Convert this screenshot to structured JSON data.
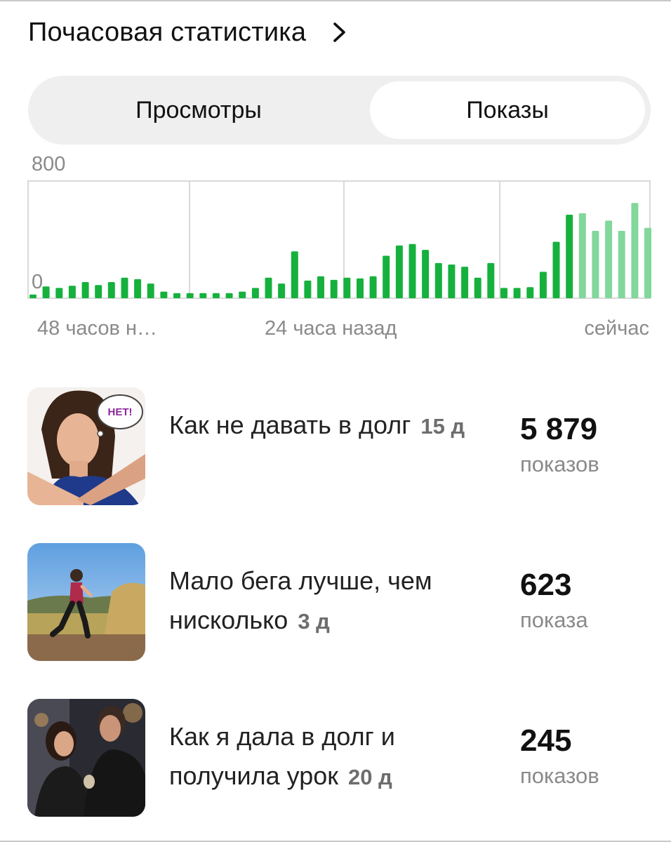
{
  "header": {
    "title": "Почасовая статистика"
  },
  "tabs": {
    "views": "Просмотры",
    "impressions": "Показы",
    "selected": "impressions"
  },
  "colors": {
    "bar_past": "#16b13d",
    "bar_recent": "#82d79b",
    "grid": "#d9d9d9"
  },
  "chart_data": {
    "type": "bar",
    "ylim": [
      0,
      800
    ],
    "y_ticks": [
      "800",
      "0"
    ],
    "x_labels": [
      "48 часов н…",
      "24 часа назад",
      "сейчас"
    ],
    "grid": true,
    "series": [
      {
        "values": [
          25,
          80,
          70,
          85,
          110,
          90,
          110,
          140,
          130,
          100,
          45,
          35,
          35,
          35,
          35,
          35,
          45,
          70,
          140,
          100,
          320,
          120,
          150,
          125,
          140,
          135,
          150,
          290,
          360,
          370,
          330,
          240,
          230,
          215,
          140,
          240,
          70,
          70,
          75,
          180,
          385,
          570,
          580,
          460,
          530,
          460,
          650,
          480
        ],
        "recent_count": 6
      }
    ]
  },
  "articles": [
    {
      "title": "Как не давать в долг",
      "age": "15 д",
      "count": "5 879",
      "unit": "показов",
      "thumb": "woman-crossed-arms-net",
      "badge": "НЕТ!"
    },
    {
      "title": "Мало бега лучше, чем нисколько",
      "age": "3 д",
      "count": "623",
      "unit": "показа",
      "thumb": "runner-landscape"
    },
    {
      "title": "Как я дала в долг и получила урок",
      "age": "20 д",
      "count": "245",
      "unit": "показов",
      "thumb": "couple-exchange"
    }
  ]
}
